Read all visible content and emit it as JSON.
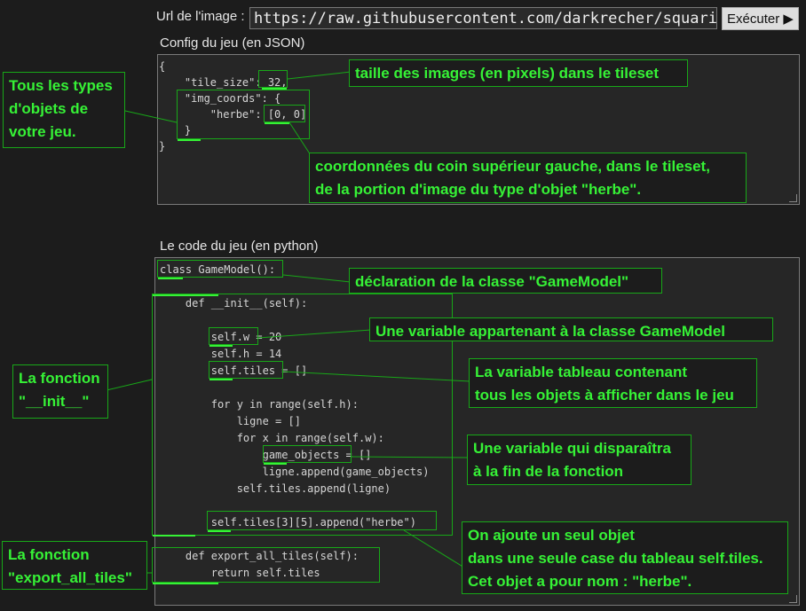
{
  "url": {
    "label": "Url de l'image :",
    "value": "https://raw.githubusercontent.com/darkrecher/squarity-doc",
    "execute_label": "Exécuter ▶"
  },
  "config": {
    "label": "Config du jeu (en JSON)",
    "lines": [
      "{",
      "    \"tile_size\": 32,",
      "    \"img_coords\": {",
      "        \"herbe\": [0, 0]",
      "    }",
      "}"
    ]
  },
  "code": {
    "label": "Le code du jeu (en python)",
    "lines": [
      "class GameModel():",
      "",
      "    def __init__(self):",
      "",
      "        self.w = 20",
      "        self.h = 14",
      "        self.tiles = []",
      "",
      "        for y in range(self.h):",
      "            ligne = []",
      "            for x in range(self.w):",
      "                game_objects = []",
      "                ligne.append(game_objects)",
      "            self.tiles.append(ligne)",
      "",
      "        self.tiles[3][5].append(\"herbe\")",
      "",
      "    def export_all_tiles(self):",
      "        return self.tiles"
    ]
  },
  "annotations": {
    "object_types": [
      "Tous les types",
      "d'objets de",
      "votre jeu."
    ],
    "tile_size": "taille des images (en pixels) dans le tileset",
    "coords": [
      "coordonnées du coin supérieur gauche, dans le tileset,",
      "de la portion d'image du type d'objet \"herbe\"."
    ],
    "class_decl": "déclaration de la classe \"GameModel\"",
    "class_var": "Une variable appartenant à la classe GameModel",
    "tiles_var": [
      "La variable tableau contenant",
      "tous les objets à afficher dans le jeu"
    ],
    "temp_var": [
      "Une variable qui disparaîtra",
      "à la fin de la fonction"
    ],
    "init_func": [
      "La fonction",
      "\"__init__\""
    ],
    "export_func": [
      "La fonction",
      "\"export_all_tiles\""
    ],
    "add_object": [
      "On ajoute un seul objet",
      "dans une seule case du tableau self.tiles.",
      "Cet objet a pour nom : \"herbe\"."
    ]
  },
  "colors": {
    "background": "#1c1c1c",
    "annotation_text": "#36f236",
    "annotation_border": "#18a818",
    "editor_background": "#262626"
  }
}
